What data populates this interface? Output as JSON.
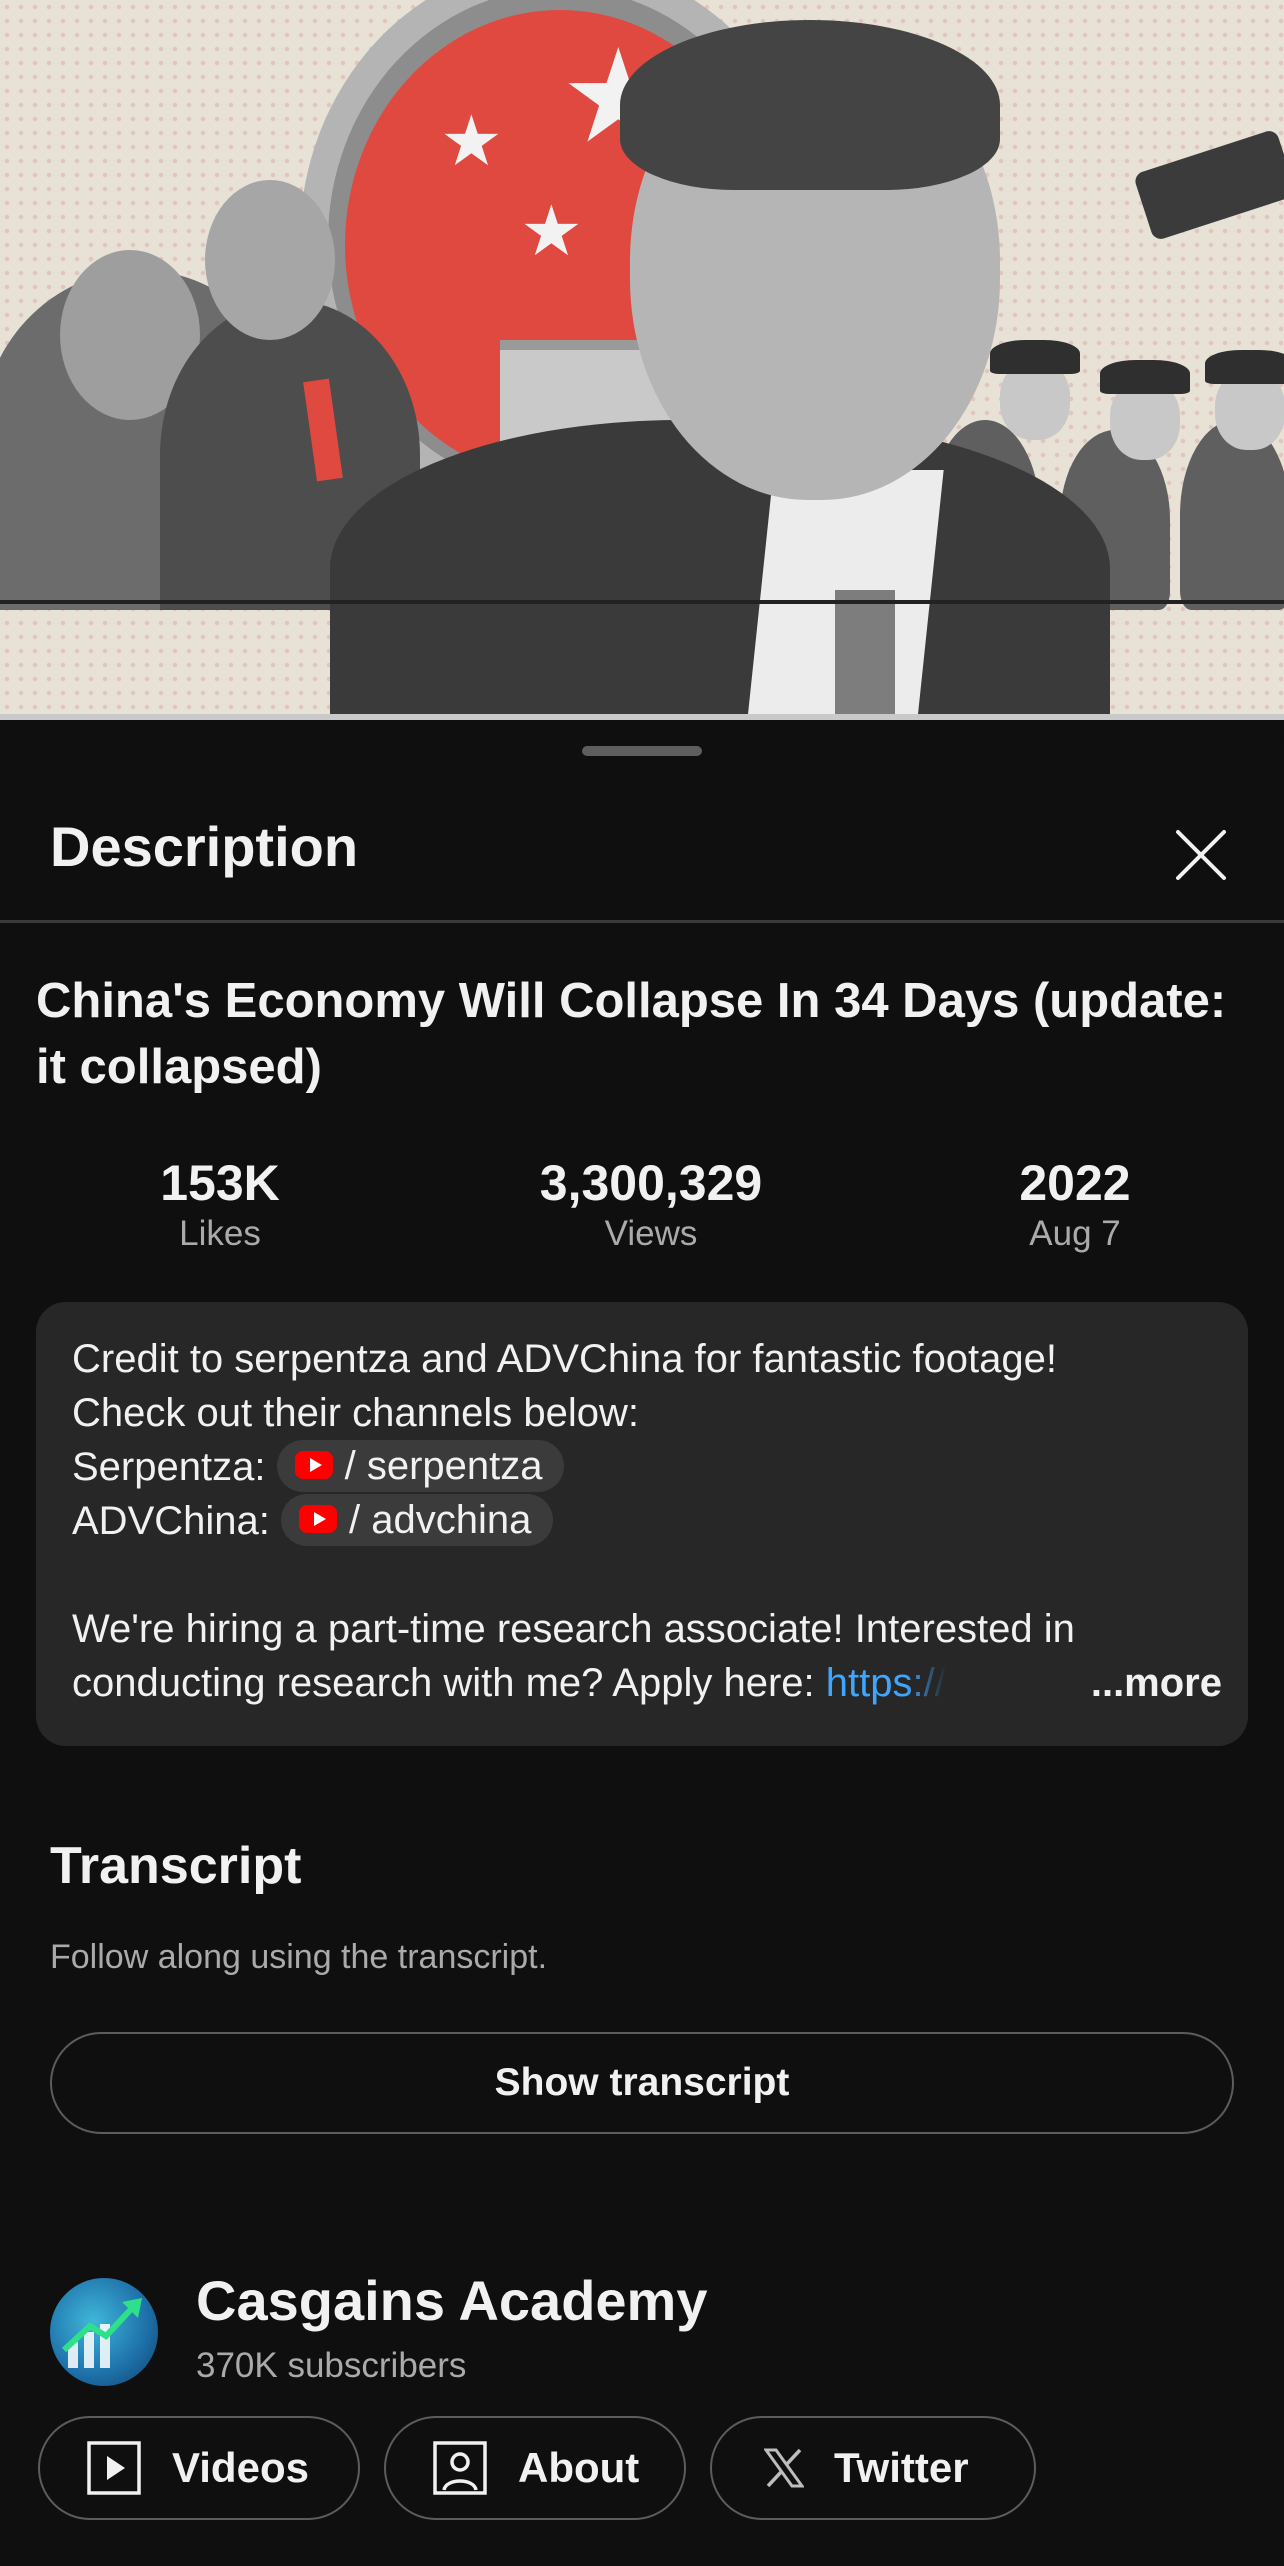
{
  "sheet": {
    "title": "Description"
  },
  "video": {
    "title": "China's Economy Will Collapse In 34 Days (update: it collapsed)",
    "stats": [
      {
        "value": "153K",
        "label": "Likes"
      },
      {
        "value": "3,300,329",
        "label": "Views"
      },
      {
        "value": "2022",
        "label": "Aug 7"
      }
    ]
  },
  "description": {
    "line1": "Credit to serpentza and ADVChina for fantastic footage!",
    "line2": "Check out their channels below:",
    "serpentza_label": "Serpentza:",
    "serpentza_link": "/ serpentza",
    "advchina_label": "ADVChina:",
    "advchina_link": "/ advchina",
    "line5": "We're hiring a part-time research associate! Interested in",
    "line6": "conducting research with me? Apply here:",
    "url_fragment": "https://",
    "more_label": "...more"
  },
  "transcript": {
    "heading": "Transcript",
    "subtitle": "Follow along using the transcript.",
    "button_label": "Show transcript"
  },
  "channel": {
    "name": "Casgains Academy",
    "subscribers": "370K subscribers",
    "buttons": [
      {
        "label": "Videos",
        "icon": "play-box-icon"
      },
      {
        "label": "About",
        "icon": "person-icon"
      },
      {
        "label": "Twitter",
        "icon": "x-logo-icon"
      }
    ]
  },
  "colors": {
    "background": "#0f0f0f",
    "card": "#272727",
    "link": "#3ea6ff",
    "youtube_red": "#ff0000",
    "secondary_text": "#aaaaaa"
  }
}
